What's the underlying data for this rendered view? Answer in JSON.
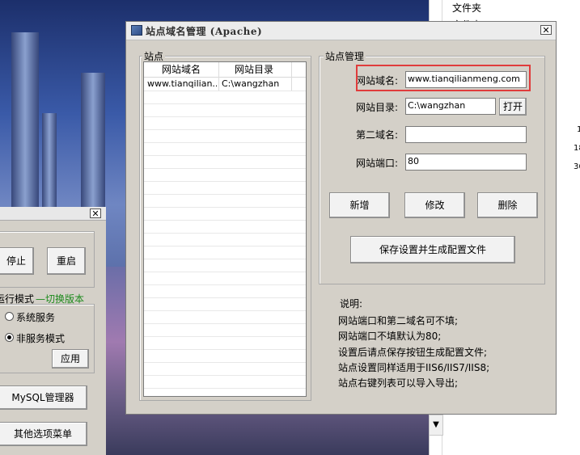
{
  "explorer": {
    "folder_label": "文件夹",
    "folder_label_2": "文件夹",
    "side_nums": [
      "1",
      "18",
      "36"
    ]
  },
  "left_window": {
    "close_glyph": "✕",
    "stop_label": "停止",
    "restart_label": "重启",
    "run_mode_label": "运行模式",
    "switch_version_label": "—切换版本",
    "service_options": [
      "系统服务",
      "非服务模式"
    ],
    "apply_label": "应用",
    "mysql_manager_label": "MySQL管理器",
    "more_menu_label": "其他选项菜单"
  },
  "dialog": {
    "title": "站点域名管理 (Apache)",
    "close_glyph": "✕",
    "site_group_title": "站点",
    "columns": [
      "网站域名",
      "网站目录"
    ],
    "rows": [
      {
        "domain": "www.tianqilian...",
        "dir": "C:\\wangzhan"
      }
    ],
    "manage_group_title": "站点管理",
    "domain_label": "网站域名:",
    "domain_value": "www.tianqilianmeng.com",
    "dir_label": "网站目录:",
    "dir_value": "C:\\wangzhan",
    "open_label": "打开",
    "second_domain_label": "第二域名:",
    "second_domain_value": "",
    "port_label": "网站端口:",
    "port_value": "80",
    "add_label": "新增",
    "modify_label": "修改",
    "delete_label": "删除",
    "save_label": "保存设置并生成配置文件",
    "notes_title": "说明:",
    "notes": [
      "网站端口和第二域名可不填;",
      "网站端口不填默认为80;",
      "设置后请点保存按钮生成配置文件;",
      "站点设置同样适用于IIS6/IIS7/IIS8;",
      "站点右键列表可以导入导出;"
    ]
  },
  "colors": {
    "highlight_box": "#e03c3c",
    "window_bg": "#d4d0c8",
    "accent_green": "#1c8a1c"
  }
}
